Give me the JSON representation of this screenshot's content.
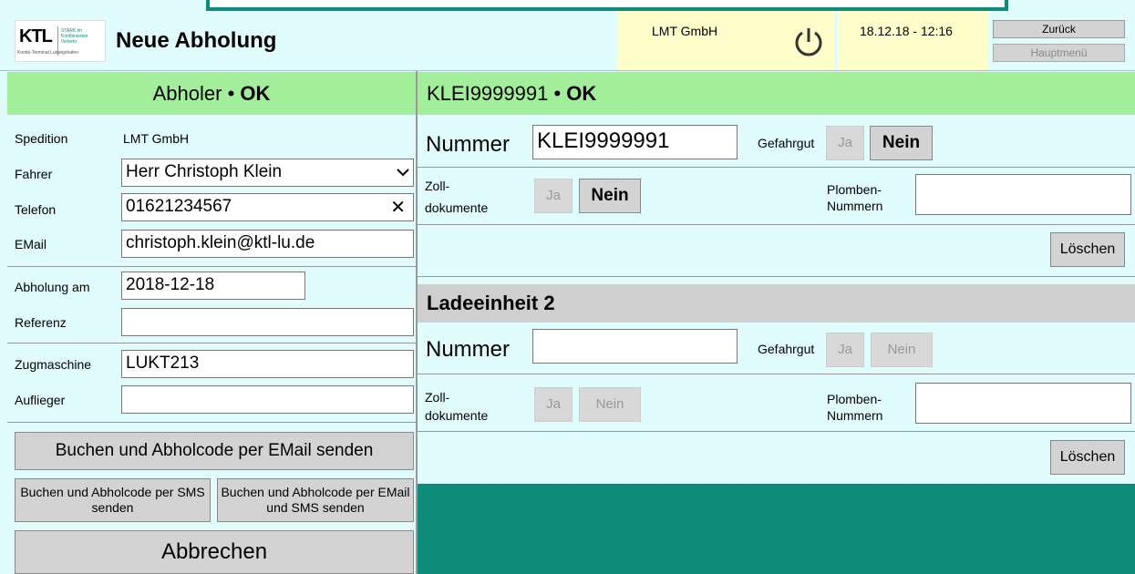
{
  "header": {
    "title": "Neue Abholung",
    "logo_text": "KTL",
    "logo_subtext": "Kombi-Terminal Ludwigshafen",
    "logo_stark": "STARK im Kombinierten Verkehr",
    "company": "LMT GmbH",
    "datetime": "18.12.18 - 12:16",
    "back_button": "Zurück",
    "main_menu_button": "Hauptmenü",
    "power_icon": "power-icon"
  },
  "left": {
    "heading_name": "Abholer",
    "heading_status": "OK",
    "spedition_label": "Spedition",
    "spedition_value": "LMT GmbH",
    "fahrer_label": "Fahrer",
    "fahrer_value": "Herr Christoph Klein",
    "telefon_label": "Telefon",
    "telefon_value": "01621234567",
    "email_label": "EMail",
    "email_value": "christoph.klein@ktl-lu.de",
    "abholung_label": "Abholung am",
    "abholung_value": "2018-12-18",
    "referenz_label": "Referenz",
    "referenz_value": "",
    "zugmaschine_label": "Zugmaschine",
    "zugmaschine_value": "LUKT213",
    "auflieger_label": "Auflieger",
    "auflieger_value": "",
    "btn_email": "Buchen und Abholcode per EMail senden",
    "btn_sms": "Buchen und Abholcode per SMS senden",
    "btn_email_sms": "Buchen und Abholcode per EMail und SMS senden",
    "btn_cancel": "Abbrechen"
  },
  "units": [
    {
      "heading": "KLEI9999991",
      "heading_status": "OK",
      "nummer_label": "Nummer",
      "nummer_value": "KLEI9999991",
      "gefahrgut_label": "Gefahrgut",
      "zoll_label_1": "Zoll-",
      "zoll_label_2": "dokumente",
      "plomben_label_1": "Plomben-",
      "plomben_label_2": "Nummern",
      "ja": "Ja",
      "nein": "Nein",
      "loeschen": "Löschen"
    },
    {
      "heading": "Ladeeinheit 2",
      "nummer_label": "Nummer",
      "nummer_value": "",
      "gefahrgut_label": "Gefahrgut",
      "zoll_label_1": "Zoll-",
      "zoll_label_2": "dokumente",
      "plomben_label_1": "Plomben-",
      "plomben_label_2": "Nummern",
      "ja": "Ja",
      "nein": "Nein",
      "loeschen": "Löschen"
    }
  ],
  "colors": {
    "background": "#e0fcfc",
    "ok_green": "#a2ee9a",
    "teal": "#0d8c7c",
    "info_yellow": "#ffffcc"
  }
}
